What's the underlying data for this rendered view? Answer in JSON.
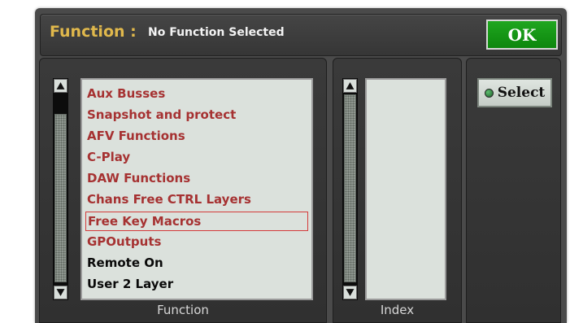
{
  "header": {
    "label": "Function :",
    "value": "No Function Selected",
    "ok_label": "OK"
  },
  "function_panel": {
    "caption": "Function",
    "items": [
      {
        "label": "Aux Busses",
        "state": "inactive",
        "selected": false
      },
      {
        "label": "Snapshot and protect",
        "state": "inactive",
        "selected": false
      },
      {
        "label": "AFV Functions",
        "state": "inactive",
        "selected": false
      },
      {
        "label": "C-Play",
        "state": "inactive",
        "selected": false
      },
      {
        "label": "DAW Functions",
        "state": "inactive",
        "selected": false
      },
      {
        "label": "Chans Free CTRL Layers",
        "state": "inactive",
        "selected": false
      },
      {
        "label": "Free Key Macros",
        "state": "inactive",
        "selected": true
      },
      {
        "label": "GPOutputs",
        "state": "inactive",
        "selected": false
      },
      {
        "label": "Remote On",
        "state": "active",
        "selected": false
      },
      {
        "label": "User 2 Layer",
        "state": "active",
        "selected": false
      }
    ]
  },
  "index_panel": {
    "caption": "Index",
    "items": []
  },
  "select_panel": {
    "select_label": "Select"
  },
  "colors": {
    "title_accent": "#e0b84c",
    "ok_green": "#14991a",
    "inactive_item": "#a63232",
    "active_item": "#0a0a0a",
    "selection_border": "#d43a3a",
    "list_background": "#dbe1dc"
  },
  "icons": {
    "scroll_up": "triangle-up-icon",
    "scroll_down": "triangle-down-icon",
    "select_led": "led-dot-icon"
  }
}
